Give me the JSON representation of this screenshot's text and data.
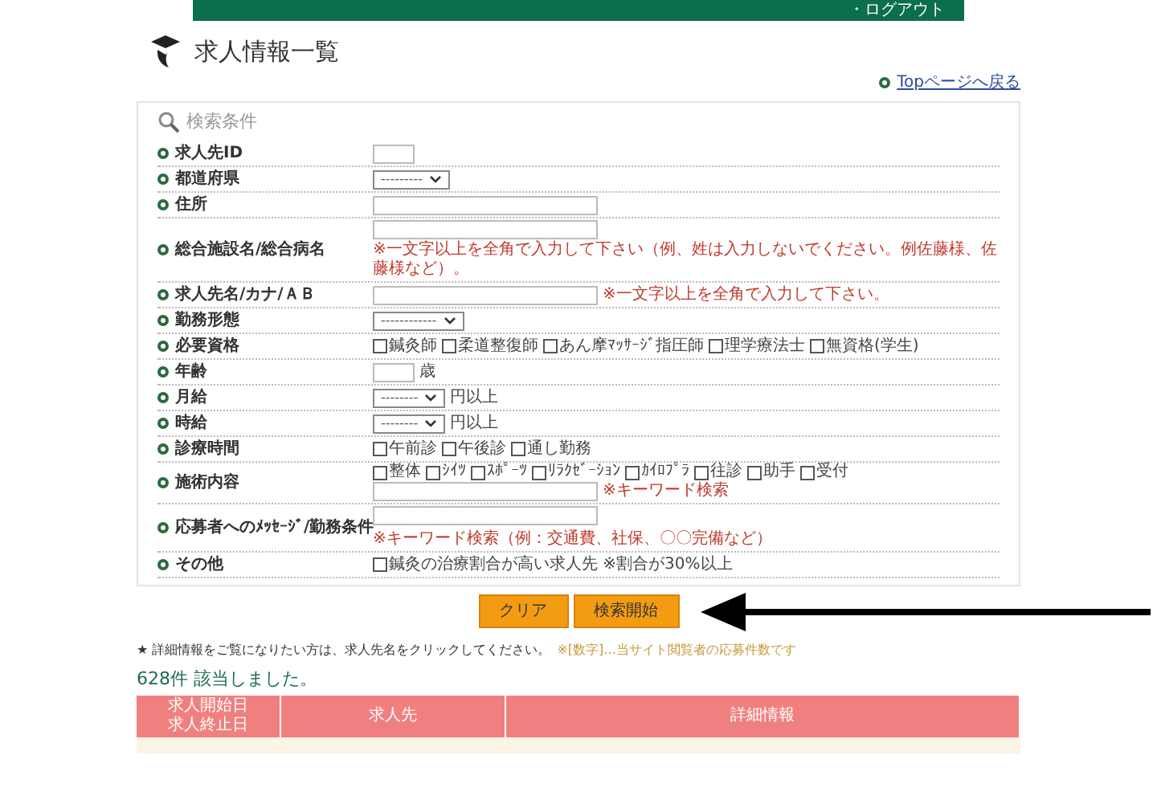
{
  "header": {
    "logout_link": "・ログアウト"
  },
  "page_title": "求人情報一覧",
  "top_link": "Topページへ戻る",
  "search": {
    "title": "検索条件",
    "rows": [
      {
        "label": "求人先ID",
        "lines": [
          [
            {
              "kind": "short-input"
            }
          ]
        ]
      },
      {
        "label": "都道府県",
        "lines": [
          [
            {
              "kind": "select",
              "value": "---------"
            }
          ]
        ]
      },
      {
        "label": "住所",
        "lines": [
          [
            {
              "kind": "input"
            }
          ]
        ]
      },
      {
        "label": "総合施設名/総合病名",
        "lines": [
          [
            {
              "kind": "input"
            }
          ],
          [
            {
              "kind": "hint",
              "text": "※一文字以上を全角で入力して下さい（例、姓は入力しないでください。例佐藤様、佐藤様など）。"
            }
          ]
        ]
      },
      {
        "label": "求人先名/カナ/ＡＢ",
        "lines": [
          [
            {
              "kind": "input"
            },
            {
              "kind": "hint",
              "text": "※一文字以上を全角で入力して下さい。"
            }
          ]
        ]
      },
      {
        "label": "勤務形態",
        "lines": [
          [
            {
              "kind": "select",
              "value": "------------"
            }
          ]
        ]
      },
      {
        "label": "必要資格",
        "lines": [
          [
            {
              "kind": "checkbox",
              "label": "鍼灸師",
              "checked": false
            },
            {
              "kind": "checkbox",
              "label": "柔道整復師",
              "checked": false
            },
            {
              "kind": "checkbox",
              "label": "あん摩ﾏｯｻｰｼﾞ指圧師",
              "checked": false
            },
            {
              "kind": "checkbox",
              "label": "理学療法士",
              "checked": false
            },
            {
              "kind": "checkbox",
              "label": "無資格(学生)",
              "checked": false
            }
          ]
        ]
      },
      {
        "label": "年齢",
        "lines": [
          [
            {
              "kind": "short-input"
            },
            {
              "kind": "text",
              "text": "歳"
            }
          ]
        ]
      },
      {
        "label": "月給",
        "lines": [
          [
            {
              "kind": "select",
              "value": "--------"
            },
            {
              "kind": "text",
              "text": "円以上"
            }
          ]
        ]
      },
      {
        "label": "時給",
        "lines": [
          [
            {
              "kind": "select",
              "value": "--------"
            },
            {
              "kind": "text",
              "text": "円以上"
            }
          ]
        ]
      },
      {
        "label": "診療時間",
        "lines": [
          [
            {
              "kind": "checkbox",
              "label": "午前診",
              "checked": false
            },
            {
              "kind": "checkbox",
              "label": "午後診",
              "checked": false
            },
            {
              "kind": "checkbox",
              "label": "通し勤務",
              "checked": false
            }
          ]
        ]
      },
      {
        "label": "施術内容",
        "lines": [
          [
            {
              "kind": "checkbox",
              "label": "整体",
              "checked": false
            },
            {
              "kind": "checkbox",
              "label": "ｼｲﾂ",
              "checked": false
            },
            {
              "kind": "checkbox",
              "label": "ｽﾎﾟｰﾂ",
              "checked": false
            },
            {
              "kind": "checkbox",
              "label": "ﾘﾗｸｾﾞｰｼｮﾝ",
              "checked": false
            },
            {
              "kind": "checkbox",
              "label": "ｶｲﾛﾌﾟﾗ",
              "checked": false
            },
            {
              "kind": "checkbox",
              "label": "往診",
              "checked": false
            },
            {
              "kind": "checkbox",
              "label": "助手",
              "checked": false
            },
            {
              "kind": "checkbox",
              "label": "受付",
              "checked": false
            }
          ],
          [
            {
              "kind": "input"
            },
            {
              "kind": "hint",
              "text": "※キーワード検索"
            }
          ]
        ]
      },
      {
        "label": "応募者へのﾒｯｾｰｼﾞ/勤務条件",
        "lines": [
          [
            {
              "kind": "input"
            },
            {
              "kind": "hint",
              "text": "※キーワード検索（例：交通費、社保、〇〇完備など）"
            }
          ]
        ]
      },
      {
        "label": "その他",
        "lines": [
          [
            {
              "kind": "checkbox",
              "label": "鍼灸の治療割合が高い求人先 ※割合が30%以上",
              "checked": false
            }
          ]
        ]
      }
    ]
  },
  "buttons": [
    "クリア",
    "検索開始"
  ],
  "note": {
    "text": "★ 詳細情報をご覧になりたい方は、求人先名をクリックしてください。",
    "hint": "※[数字]…当サイト閲覧者の応募件数です"
  },
  "result_count": "628件 該当しました。",
  "table": {
    "columns": [
      [
        "求人開始日",
        "求人終止日"
      ],
      [
        "求人先"
      ],
      [
        "詳細情報"
      ]
    ]
  }
}
